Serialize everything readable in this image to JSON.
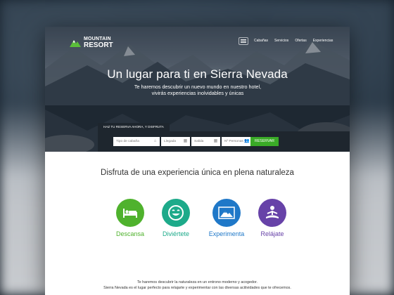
{
  "brand": {
    "line1": "MOUNTAIN",
    "line2": "RESORT",
    "color": "#5bbf3a"
  },
  "nav": {
    "items": [
      "Cabañas",
      "Servicios",
      "Ofertas",
      "Experiencias"
    ]
  },
  "hero": {
    "title": "Un lugar para ti en Sierra Nevada",
    "subtitle": "Te haremos descubrir un nuevo mundo en nuestro hotel, vivirás experiencias inolvidables y únicas"
  },
  "booking": {
    "tab_label": "HAZ TU RESERVA AHORA, Y DISFRUTA",
    "cabin_placeholder": "Tipo de cabaña",
    "checkin_placeholder": "Llegada",
    "checkout_placeholder": "Salida",
    "persons_placeholder": "Nº Personas",
    "submit_label": "RESERVAR",
    "button_color": "#3aab27"
  },
  "section": {
    "title": "Disfruta de una experiencia única en plena naturaleza"
  },
  "features": [
    {
      "label": "Descansa",
      "icon": "bed-icon",
      "color": "#4fb22d"
    },
    {
      "label": "Diviértete",
      "icon": "smile-icon",
      "color": "#1daa8a"
    },
    {
      "label": "Experimenta",
      "icon": "mountain-icon",
      "color": "#1f78c8"
    },
    {
      "label": "Relájate",
      "icon": "meditation-icon",
      "color": "#6742a8"
    }
  ],
  "description": {
    "line1": "Te haremos descubrir la naturaleza en un entrono moderno y acogedor.",
    "line2": "Sierra Nevada es el lugar perfecto para relajarte y experimentar con las diversas acitividades que te ofrecemos."
  }
}
